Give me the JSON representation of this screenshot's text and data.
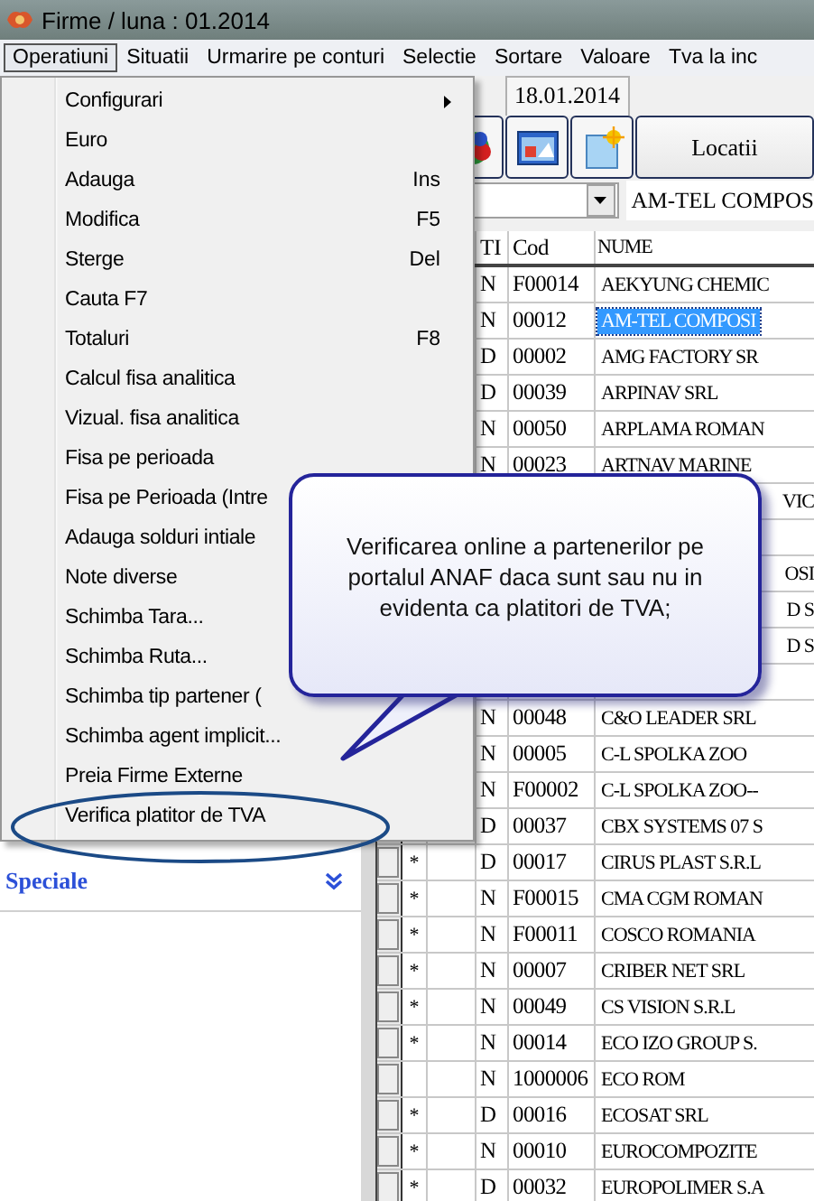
{
  "window": {
    "title": "Firme  / luna : 01.2014"
  },
  "menubar": [
    {
      "label": "Operatiuni",
      "selected": true
    },
    {
      "label": "Situatii",
      "selected": false
    },
    {
      "label": "Urmarire pe conturi",
      "selected": false
    },
    {
      "label": "Selectie",
      "selected": false
    },
    {
      "label": "Sortare",
      "selected": false
    },
    {
      "label": "Valoare",
      "selected": false
    },
    {
      "label": "Tva la inc",
      "selected": false
    }
  ],
  "date_tab": "18.01.2014",
  "locatii_button": "Locatii",
  "combo_value": "AM-TEL COMPOS",
  "table": {
    "columns": [
      "TI",
      "Cod",
      "NUME"
    ],
    "rows": [
      {
        "kind": "row",
        "ti": "N",
        "cod": "F00014",
        "nume": "AEKYUNG CHEMIC",
        "selected": false
      },
      {
        "kind": "row",
        "ti": "N",
        "cod": "00012",
        "nume": "AM-TEL COMPOSI",
        "selected": true
      },
      {
        "kind": "row",
        "ti": "D",
        "cod": "00002",
        "nume": "AMG FACTORY SR",
        "selected": false
      },
      {
        "kind": "row",
        "ti": "D",
        "cod": "00039",
        "nume": "ARPINAV SRL",
        "selected": false
      },
      {
        "kind": "row",
        "ti": "N",
        "cod": "00050",
        "nume": "ARPLAMA ROMAN",
        "selected": false
      },
      {
        "kind": "row",
        "ti": "N",
        "cod": "00023",
        "nume": "ARTNAV MARINE",
        "selected": false
      },
      {
        "kind": "covered",
        "fragment": "VIC"
      },
      {
        "kind": "covered"
      },
      {
        "kind": "covered",
        "fragment": "OSI"
      },
      {
        "kind": "covered",
        "fragment": "D S"
      },
      {
        "kind": "covered",
        "fragment": "D S"
      },
      {
        "kind": "covered"
      },
      {
        "kind": "row",
        "ti": "N",
        "cod": "00048",
        "nume": "C&O LEADER SRL",
        "selected": false
      },
      {
        "kind": "row",
        "ti": "N",
        "cod": "00005",
        "nume": "C-L SPOLKA ZOO",
        "selected": false
      },
      {
        "kind": "row",
        "ti": "N",
        "cod": "F00002",
        "nume": "C-L SPOLKA ZOO--",
        "selected": false
      },
      {
        "kind": "row",
        "ti": "D",
        "cod": "00037",
        "nume": "CBX SYSTEMS 07 S",
        "selected": false
      },
      {
        "kind": "row",
        "flag": "*",
        "ti": "D",
        "cod": "00017",
        "nume": "CIRUS PLAST S.R.L",
        "selected": false
      },
      {
        "kind": "row",
        "flag": "*",
        "ti": "N",
        "cod": "F00015",
        "nume": "CMA CGM ROMAN",
        "selected": false
      },
      {
        "kind": "row",
        "flag": "*",
        "ti": "N",
        "cod": "F00011",
        "nume": "COSCO ROMANIA",
        "selected": false
      },
      {
        "kind": "row",
        "flag": "*",
        "ti": "N",
        "cod": "00007",
        "nume": "CRIBER NET SRL",
        "selected": false
      },
      {
        "kind": "row",
        "flag": "*",
        "ti": "N",
        "cod": "00049",
        "nume": "CS VISION S.R.L",
        "selected": false
      },
      {
        "kind": "row",
        "flag": "*",
        "ti": "N",
        "cod": "00014",
        "nume": "ECO IZO GROUP S.",
        "selected": false
      },
      {
        "kind": "row",
        "ti": "N",
        "cod": "1000006",
        "nume": "ECO ROM",
        "selected": false
      },
      {
        "kind": "row",
        "flag": "*",
        "ti": "D",
        "cod": "00016",
        "nume": "ECOSAT SRL",
        "selected": false
      },
      {
        "kind": "row",
        "flag": "*",
        "ti": "N",
        "cod": "00010",
        "nume": "EUROCOMPOZITE",
        "selected": false
      },
      {
        "kind": "row",
        "flag": "*",
        "ti": "D",
        "cod": "00032",
        "nume": "EUROPOLIMER S.A",
        "selected": false
      }
    ]
  },
  "sidebar": {
    "section": "Speciale"
  },
  "dropdown_menu": [
    {
      "label": "Configurari",
      "submenu": true
    },
    {
      "label": "Euro"
    },
    {
      "label": "Adauga",
      "shortcut": "Ins"
    },
    {
      "label": "Modifica",
      "shortcut": "F5"
    },
    {
      "label": "Sterge",
      "shortcut": "Del"
    },
    {
      "label": "Cauta F7"
    },
    {
      "label": "Totaluri",
      "shortcut": "F8"
    },
    {
      "label": "Calcul fisa analitica"
    },
    {
      "label": "Vizual. fisa analitica"
    },
    {
      "label": "Fisa pe perioada"
    },
    {
      "label": "Fisa pe Perioada (Intre"
    },
    {
      "label": "Adauga solduri intiale"
    },
    {
      "label": "Note diverse"
    },
    {
      "label": "Schimba Tara..."
    },
    {
      "label": "Schimba Ruta..."
    },
    {
      "label": "Schimba tip partener ("
    },
    {
      "label": "Schimba agent implicit..."
    },
    {
      "label": "Preia Firme Externe"
    },
    {
      "label": "Verifica platitor de TVA",
      "circled": true
    }
  ],
  "callout": {
    "lines": [
      "Verificarea online a partenerilor pe",
      "portalul ANAF daca sunt sau nu in",
      "evidenta ca platitori de TVA;"
    ]
  }
}
